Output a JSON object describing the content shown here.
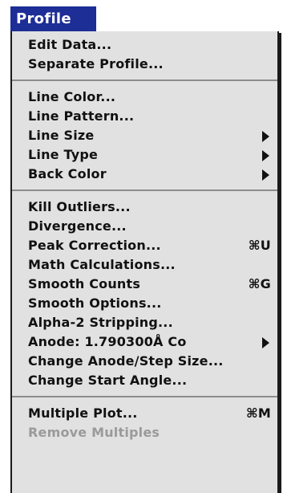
{
  "menu": {
    "title": "Profile",
    "items": {
      "edit_data": "Edit Data...",
      "separate_profile": "Separate Profile...",
      "line_color": "Line Color...",
      "line_pattern": "Line Pattern...",
      "line_size": "Line Size",
      "line_type": "Line Type",
      "back_color": "Back Color",
      "kill_outliers": "Kill Outliers...",
      "divergence": "Divergence...",
      "peak_correction": "Peak Correction...",
      "math_calculations": "Math Calculations...",
      "smooth_counts": "Smooth Counts",
      "smooth_options": "Smooth Options...",
      "alpha2_stripping": "Alpha-2 Stripping...",
      "anode": "Anode: 1.790300Å Co",
      "change_anode_step": "Change Anode/Step Size...",
      "change_start_angle": "Change Start Angle...",
      "multiple_plot": "Multiple Plot...",
      "remove_multiples": "Remove Multiples"
    },
    "shortcuts": {
      "peak_correction": "⌘U",
      "smooth_counts": "⌘G",
      "multiple_plot": "⌘M"
    }
  }
}
